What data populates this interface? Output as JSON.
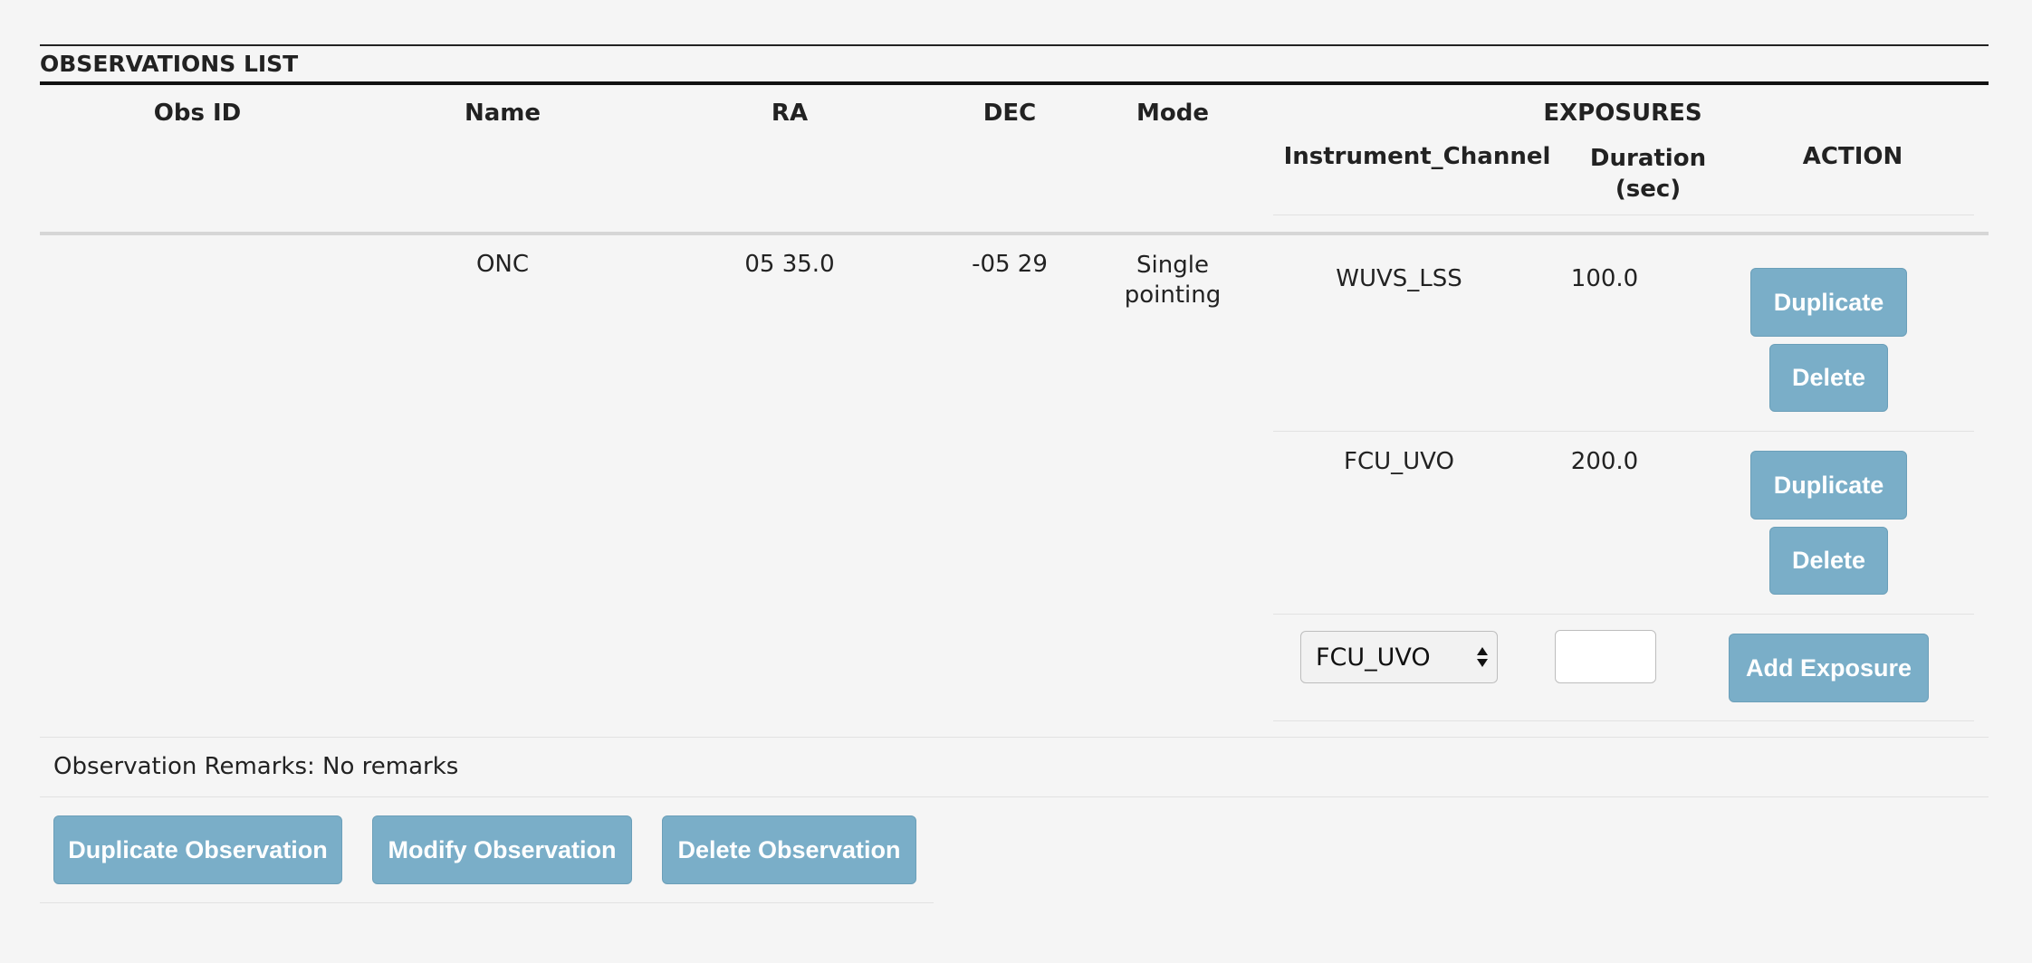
{
  "section": {
    "title": "OBSERVATIONS LIST"
  },
  "table": {
    "headers": {
      "obs_id": "Obs ID",
      "name": "Name",
      "ra": "RA",
      "dec": "DEC",
      "mode": "Mode",
      "exposures": "EXPOSURES",
      "instrument_channel": "Instrument_Channel",
      "duration_line1": "Duration",
      "duration_line2": "(sec)",
      "action": "ACTION"
    },
    "row": {
      "obs_id": "",
      "name": "ONC",
      "ra": "05 35.0",
      "dec": "-05 29",
      "mode_line1": "Single",
      "mode_line2": "pointing"
    },
    "exposures": [
      {
        "instrument_channel": "WUVS_LSS",
        "duration": "100.0",
        "duplicate_label": "Duplicate",
        "delete_label": "Delete"
      },
      {
        "instrument_channel": "FCU_UVO",
        "duration": "200.0",
        "duplicate_label": "Duplicate",
        "delete_label": "Delete"
      }
    ],
    "add_exposure": {
      "channel_selected": "FCU_UVO",
      "duration_value": "",
      "button_label": "Add Exposure"
    }
  },
  "remarks": {
    "text": "Observation Remarks: No remarks"
  },
  "actions": {
    "duplicate_label": "Duplicate Observation",
    "modify_label": "Modify Observation",
    "delete_label": "Delete Observation"
  },
  "colors": {
    "button_bg": "#7aaec8",
    "page_bg": "#f5f5f5",
    "rule": "#111111"
  }
}
